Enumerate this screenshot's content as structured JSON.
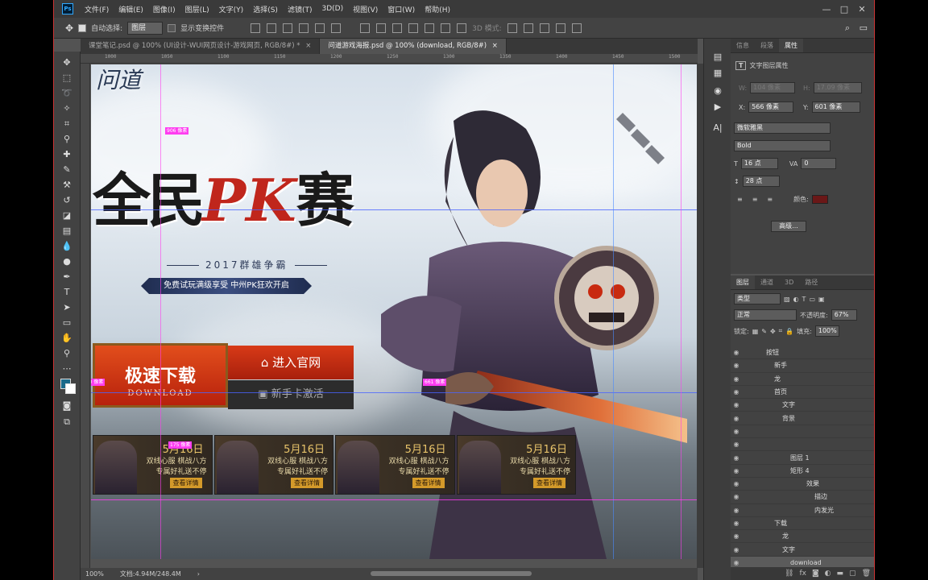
{
  "app": {
    "logo": "Ps"
  },
  "menu": [
    "文件(F)",
    "编辑(E)",
    "图像(I)",
    "图层(L)",
    "文字(Y)",
    "选择(S)",
    "滤镜(T)",
    "3D(D)",
    "视图(V)",
    "窗口(W)",
    "帮助(H)"
  ],
  "window_controls": [
    "—",
    "□",
    "✕"
  ],
  "options": {
    "auto_select_label": "自动选择:",
    "auto_select_value": "图层",
    "show_transform_label": "显示变换控件",
    "mode_3d_label": "3D 模式:"
  },
  "tabs": [
    {
      "label": "课堂笔记.psd @ 100% (UI设计-WUI网页设计-游戏网页, RGB/8#) *",
      "close": "×"
    },
    {
      "label": "问道游戏海报.psd @ 100% (download, RGB/8#)",
      "close": "×"
    }
  ],
  "ruler": [
    "1000",
    "1050",
    "1100",
    "1150",
    "1200",
    "1250",
    "1300",
    "1350",
    "1400",
    "1450",
    "1500"
  ],
  "tool_icons": [
    "move-icon",
    "marquee-icon",
    "lasso-icon",
    "magic-wand-icon",
    "crop-icon",
    "eyedropper-icon",
    "healing-icon",
    "brush-icon",
    "stamp-icon",
    "history-brush-icon",
    "eraser-icon",
    "gradient-icon",
    "blur-icon",
    "dodge-icon",
    "pen-icon",
    "type-icon",
    "path-select-icon",
    "rectangle-icon",
    "hand-icon",
    "zoom-icon"
  ],
  "canvas": {
    "logo_text": "问道",
    "title_a": "全民",
    "title_pk": "PK",
    "title_b": "赛",
    "subtitle": "2017群雄争霸",
    "ribbon": "免费试玩满级享受 中州PK狂欢开启",
    "download_title": "极速下载",
    "download_sub": "DOWNLOAD",
    "official_button": "进入官网",
    "code_button": "新手卡激活",
    "measures": [
      "906 像素",
      "130 像素",
      "661 像素",
      "175 像素"
    ],
    "cards": [
      {
        "date": "5月16日",
        "line1": "双线心服 棋战八方",
        "line2": "专属好礼送不停",
        "more": "查看详情"
      },
      {
        "date": "5月16日",
        "line1": "双线心服 棋战八方",
        "line2": "专属好礼送不停",
        "more": "查看详情"
      },
      {
        "date": "5月16日",
        "line1": "双线心服 棋战八方",
        "line2": "专属好礼送不停",
        "more": "查看详情"
      },
      {
        "date": "5月16日",
        "line1": "双线心服 棋战八方",
        "line2": "专属好礼送不停",
        "more": "查看详情"
      }
    ]
  },
  "status": {
    "zoom": "100%",
    "doc": "文档:4.94M/248.4M"
  },
  "properties": {
    "tabs": [
      "信息",
      "段落",
      "属性"
    ],
    "header": "文字图层属性",
    "w_label": "W:",
    "w_value": "104 像素",
    "h_label": "H:",
    "h_value": "17.09 像素",
    "x_label": "X:",
    "x_value": "566 像素",
    "y_label": "Y:",
    "y_value": "601 像素",
    "font_family": "微软雅黑",
    "font_style": "Bold",
    "font_size": "16 点",
    "tracking": "0",
    "leading": "28 点",
    "color_label": "颜色:",
    "advanced_button": "高级..."
  },
  "layers_panel": {
    "tabs": [
      "图层",
      "通道",
      "3D",
      "路径"
    ],
    "filter_label": "类型",
    "blend_mode": "正常",
    "opacity_label": "不透明度:",
    "opacity_value": "67%",
    "lock_label": "锁定:",
    "fill_label": "填充:",
    "fill_value": "100%",
    "items": [
      {
        "name": "按钮",
        "indent": 30
      },
      {
        "name": "新手",
        "indent": 40
      },
      {
        "name": "龙",
        "indent": 40
      },
      {
        "name": "首页",
        "indent": 40
      },
      {
        "name": "文字",
        "indent": 50
      },
      {
        "name": "背景",
        "indent": 50
      },
      {
        "name": "",
        "indent": 60
      },
      {
        "name": "",
        "indent": 60
      },
      {
        "name": "图层 1",
        "indent": 60
      },
      {
        "name": "矩形 4",
        "indent": 60
      },
      {
        "name": "效果",
        "indent": 80
      },
      {
        "name": "描边",
        "indent": 90
      },
      {
        "name": "内发光",
        "indent": 90
      },
      {
        "name": "下载",
        "indent": 40
      },
      {
        "name": "龙",
        "indent": 50
      },
      {
        "name": "文字",
        "indent": 50
      },
      {
        "name": "download",
        "indent": 60
      }
    ]
  }
}
